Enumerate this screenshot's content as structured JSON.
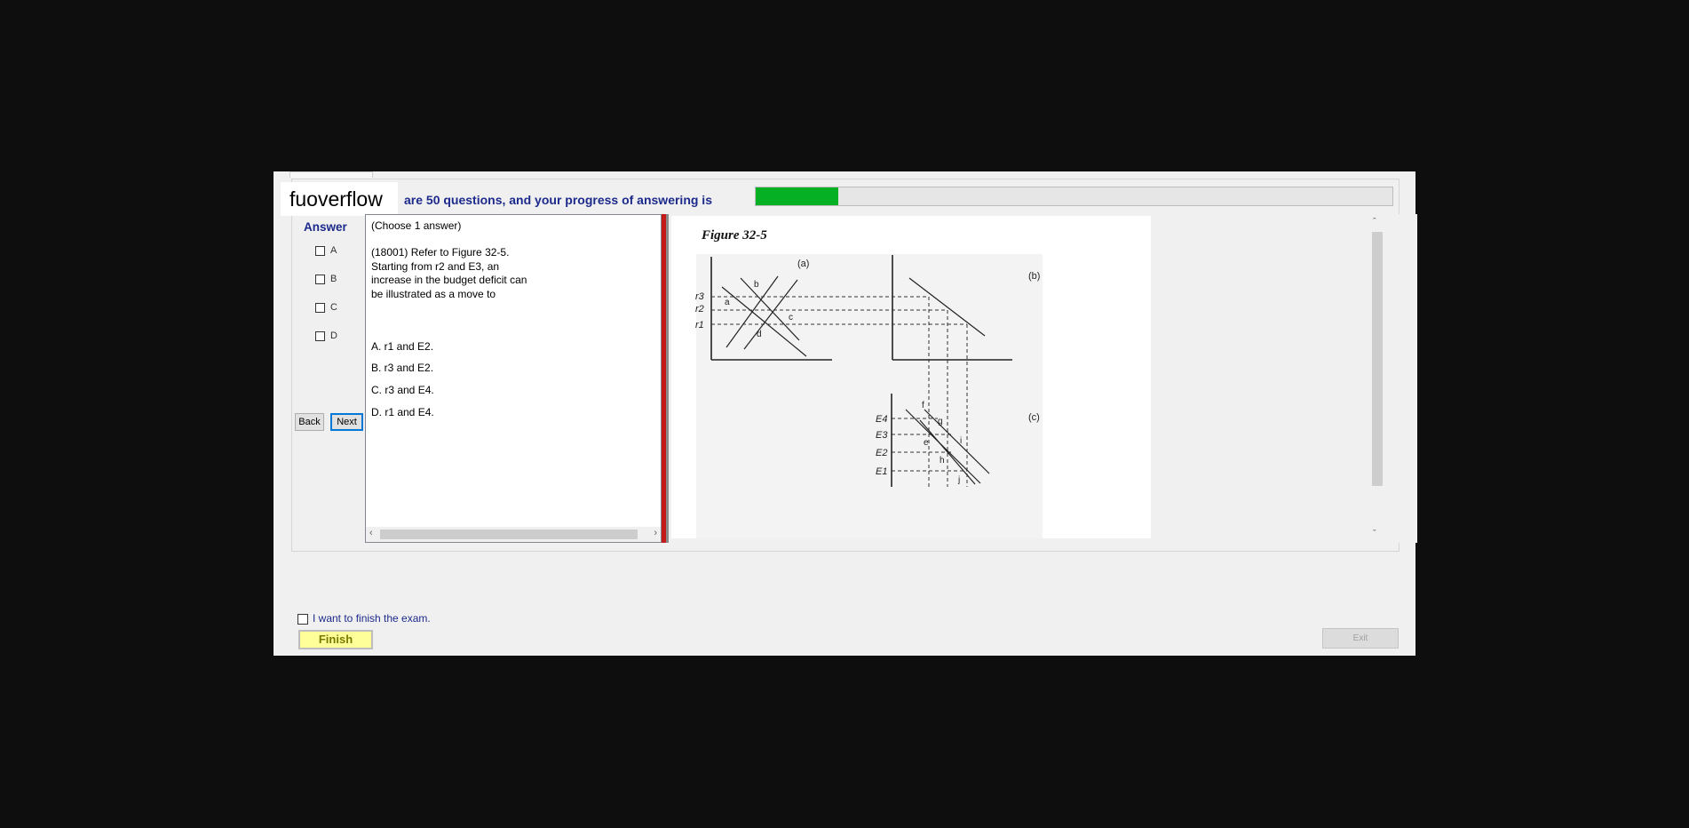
{
  "logo": {
    "text": "fuoverflow"
  },
  "progress": {
    "text": "are 50 questions, and your progress of answering is",
    "fraction": 0.13,
    "fill_color": "#06b025"
  },
  "answer_panel": {
    "heading": "Answer",
    "options": [
      "A",
      "B",
      "C",
      "D"
    ],
    "back_label": "Back",
    "next_label": "Next"
  },
  "question": {
    "instruction": "(Choose 1 answer)",
    "stem_lines": [
      "(18001)  Refer to Figure 32-5.",
      "Starting from r2 and E3, an",
      "increase in the budget deficit can",
      "be illustrated as a move to"
    ],
    "choices": [
      "A.  r1 and E2.",
      "B.  r3 and E2.",
      "C.  r3 and E4.",
      "D.  r1 and E4."
    ]
  },
  "figure": {
    "title": "Figure 32-5",
    "panel_a": "(a)",
    "panel_b": "(b)",
    "panel_c": "(c)",
    "rates": [
      "r3",
      "r2",
      "r1"
    ],
    "exports": [
      "E4",
      "E3",
      "E2",
      "E1"
    ],
    "points": [
      "a",
      "b",
      "c",
      "d",
      "e",
      "f",
      "g",
      "h",
      "i",
      "j"
    ]
  },
  "footer": {
    "finish_check_label": "I want to finish the exam.",
    "finish_label": "Finish",
    "exit_label": "Exit"
  },
  "colors": {
    "accent_text": "#1c2a8c",
    "divider": "#c41a1a",
    "finish_bg": "#ffff99"
  }
}
